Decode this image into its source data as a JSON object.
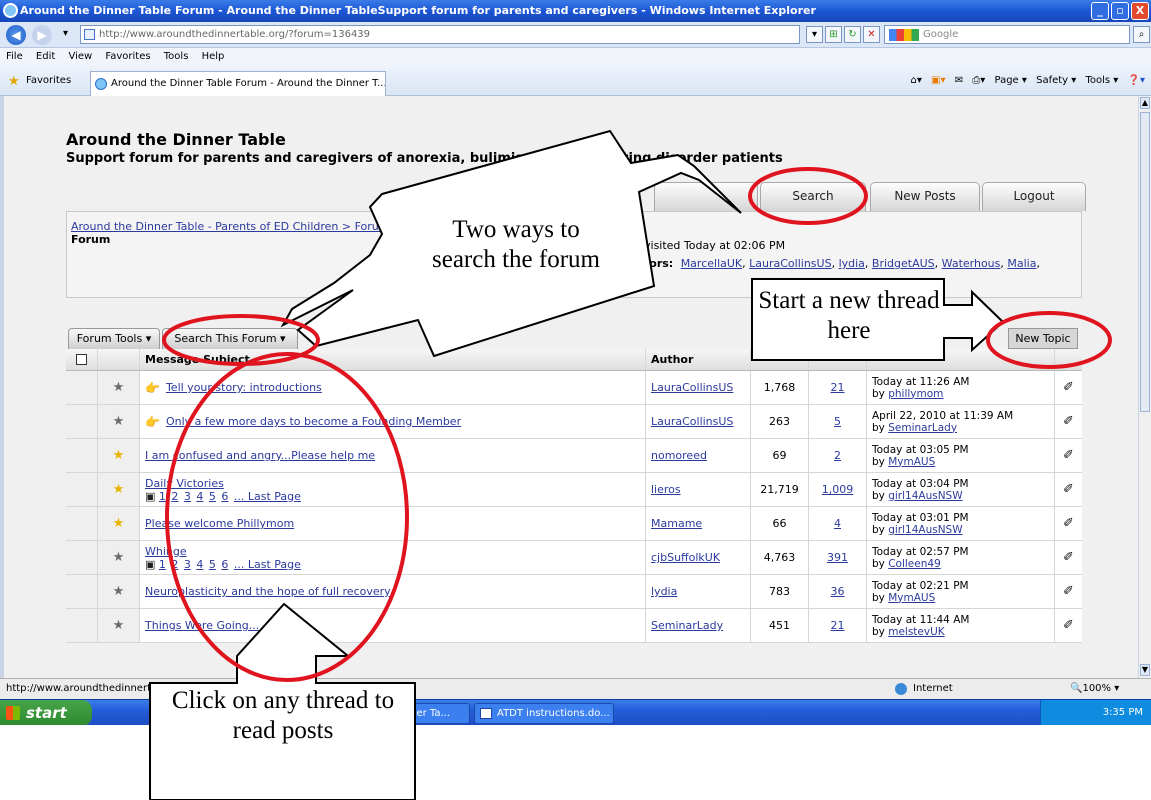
{
  "window": {
    "title": "Around the Dinner Table Forum - Around the Dinner TableSupport forum for parents and caregivers - Windows Internet Explorer",
    "buttons": [
      "_",
      "▫",
      "X"
    ]
  },
  "browser": {
    "url": "http://www.aroundthedinnertable.org/?forum=136439",
    "search_placeholder": "Google",
    "menu": [
      "File",
      "Edit",
      "View",
      "Favorites",
      "Tools",
      "Help"
    ],
    "favorites_label": "Favorites",
    "tab_title": "Around the Dinner Table Forum - Around the Dinner T...",
    "command_bar": [
      "Page ▾",
      "Safety ▾",
      "Tools ▾"
    ]
  },
  "site": {
    "title": "Around the Dinner Table",
    "subtitle": "Support forum for parents and caregivers of anorexia, bulimia and other eating disorder patients",
    "nav_tabs": [
      "Search",
      "New Posts",
      "Logout"
    ],
    "breadcrumb": "Around the Dinner Table - Parents of ED Children > Forum",
    "breadcrumb_current": "Forum",
    "last_visited": "visited Today at 02:06 PM",
    "visitors_label": "tors:",
    "visitors": [
      "MarcellaUK",
      "LauraCollinsUS",
      "lydia",
      "BridgetAUS",
      "Waterhous",
      "Malia"
    ]
  },
  "forum": {
    "tools_tab": "Forum Tools ▾",
    "search_tab": "Search This Forum ▾",
    "new_topic": "New Topic",
    "headers": {
      "subject": "Message Subject",
      "author": "Author"
    },
    "threads": [
      {
        "star": "grey",
        "icon": true,
        "subject": "Tell your story: introductions",
        "pages": [],
        "author": "LauraCollinsUS",
        "views": "1,768",
        "replies": "21",
        "last": "Today at 11:26 AM",
        "by": "phillymom"
      },
      {
        "star": "grey",
        "icon": true,
        "subject": "Only a few more days to become a Founding Member",
        "pages": [],
        "author": "LauraCollinsUS",
        "views": "263",
        "replies": "5",
        "last": "April 22, 2010 at 11:39 AM",
        "by": "SeminarLady"
      },
      {
        "star": "gold",
        "icon": false,
        "subject": "I am confused and angry...Please help me",
        "pages": [],
        "author": "nomoreed",
        "views": "69",
        "replies": "2",
        "last": "Today at 03:05 PM",
        "by": "MymAUS"
      },
      {
        "star": "gold",
        "icon": false,
        "subject": "Daily Victories",
        "pages": [
          "1",
          "2",
          "3",
          "4",
          "5",
          "6"
        ],
        "pages_suffix": "... Last Page",
        "author": "lieros",
        "views": "21,719",
        "replies": "1,009",
        "last": "Today at 03:04 PM",
        "by": "girl14AusNSW"
      },
      {
        "star": "gold",
        "icon": false,
        "subject": "Please welcome Phillymom",
        "pages": [],
        "author": "Mamame",
        "views": "66",
        "replies": "4",
        "last": "Today at 03:01 PM",
        "by": "girl14AusNSW"
      },
      {
        "star": "grey",
        "icon": false,
        "subject": "Whinge",
        "pages": [
          "1",
          "2",
          "3",
          "4",
          "5",
          "6"
        ],
        "pages_suffix": "... Last Page",
        "author": "cjbSuffolkUK",
        "views": "4,763",
        "replies": "391",
        "last": "Today at 02:57 PM",
        "by": "Colleen49"
      },
      {
        "star": "grey",
        "icon": false,
        "subject": "Neuroplasticity and the hope of full recovery",
        "pages": [],
        "author": "lydia",
        "views": "783",
        "replies": "36",
        "last": "Today at 02:21 PM",
        "by": "MymAUS"
      },
      {
        "star": "grey",
        "icon": false,
        "subject": "Things Were Going...",
        "pages": [],
        "author": "SeminarLady",
        "views": "451",
        "replies": "21",
        "last": "Today at 11:44 AM",
        "by": "melstevUK"
      }
    ]
  },
  "status": {
    "url": "http://www.aroundthedinnertabl",
    "zone": "Internet",
    "zoom": "100%"
  },
  "taskbar": {
    "start": "start",
    "items": [
      "inner Ta...",
      "ATDT instructions.do..."
    ],
    "clock": "3:35 PM"
  },
  "annotations": {
    "search_callout": "Two ways to search the forum",
    "new_thread_callout": "Start a new thread here",
    "click_callout": "Click on any thread to read posts"
  },
  "colors": {
    "annotation_circle": "#e0141e",
    "link": "#2b3a9d"
  }
}
